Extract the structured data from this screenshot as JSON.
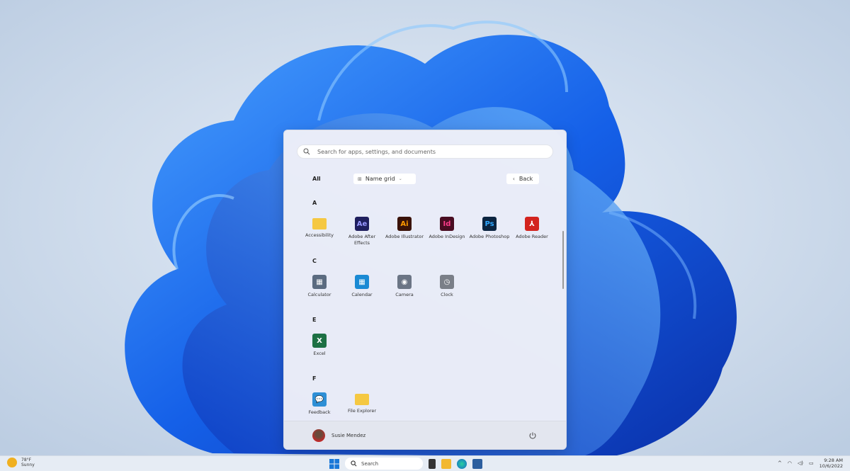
{
  "start_menu": {
    "search_placeholder": "Search for apps, settings, and documents",
    "all_label": "All",
    "view_dropdown": "Name grid",
    "back_label": "Back",
    "sections": [
      {
        "letter": "A",
        "apps": [
          {
            "name": "Accessibility",
            "icon": "folder-icon",
            "glyph": "",
            "color": "#f5c842"
          },
          {
            "name": "Adobe After Effects",
            "icon": "after-effects-icon",
            "glyph": "Ae",
            "color": "#1f1f5e"
          },
          {
            "name": "Adobe Illustrator",
            "icon": "illustrator-icon",
            "glyph": "Ai",
            "color": "#3a1208"
          },
          {
            "name": "Adobe InDesign",
            "icon": "indesign-icon",
            "glyph": "Id",
            "color": "#4a0d22"
          },
          {
            "name": "Adobe Photoshop",
            "icon": "photoshop-icon",
            "glyph": "Ps",
            "color": "#0b2440"
          },
          {
            "name": "Adobe Reader",
            "icon": "acrobat-icon",
            "glyph": "⅄",
            "color": "#d3231e"
          }
        ]
      },
      {
        "letter": "C",
        "apps": [
          {
            "name": "Calculator",
            "icon": "calculator-icon",
            "glyph": "▦",
            "color": "#5b6b80"
          },
          {
            "name": "Calendar",
            "icon": "calendar-icon",
            "glyph": "▦",
            "color": "#1a8ad4"
          },
          {
            "name": "Camera",
            "icon": "camera-icon",
            "glyph": "◉",
            "color": "#6b7585"
          },
          {
            "name": "Clock",
            "icon": "clock-icon",
            "glyph": "◷",
            "color": "#7a7f88"
          }
        ]
      },
      {
        "letter": "E",
        "apps": [
          {
            "name": "Excel",
            "icon": "excel-icon",
            "glyph": "X",
            "color": "#1d7044"
          }
        ]
      },
      {
        "letter": "F",
        "apps": [
          {
            "name": "Feedback",
            "icon": "feedback-icon",
            "glyph": "💬",
            "color": "#2e8fd6"
          },
          {
            "name": "File Explorer",
            "icon": "file-explorer-icon",
            "glyph": "",
            "color": "#f5c842"
          }
        ]
      }
    ],
    "user_name": "Susie Mendez"
  },
  "taskbar": {
    "weather_temp": "78°F",
    "weather_desc": "Sunny",
    "search_label": "Search",
    "time": "9:28 AM",
    "date": "10/6/2022"
  }
}
